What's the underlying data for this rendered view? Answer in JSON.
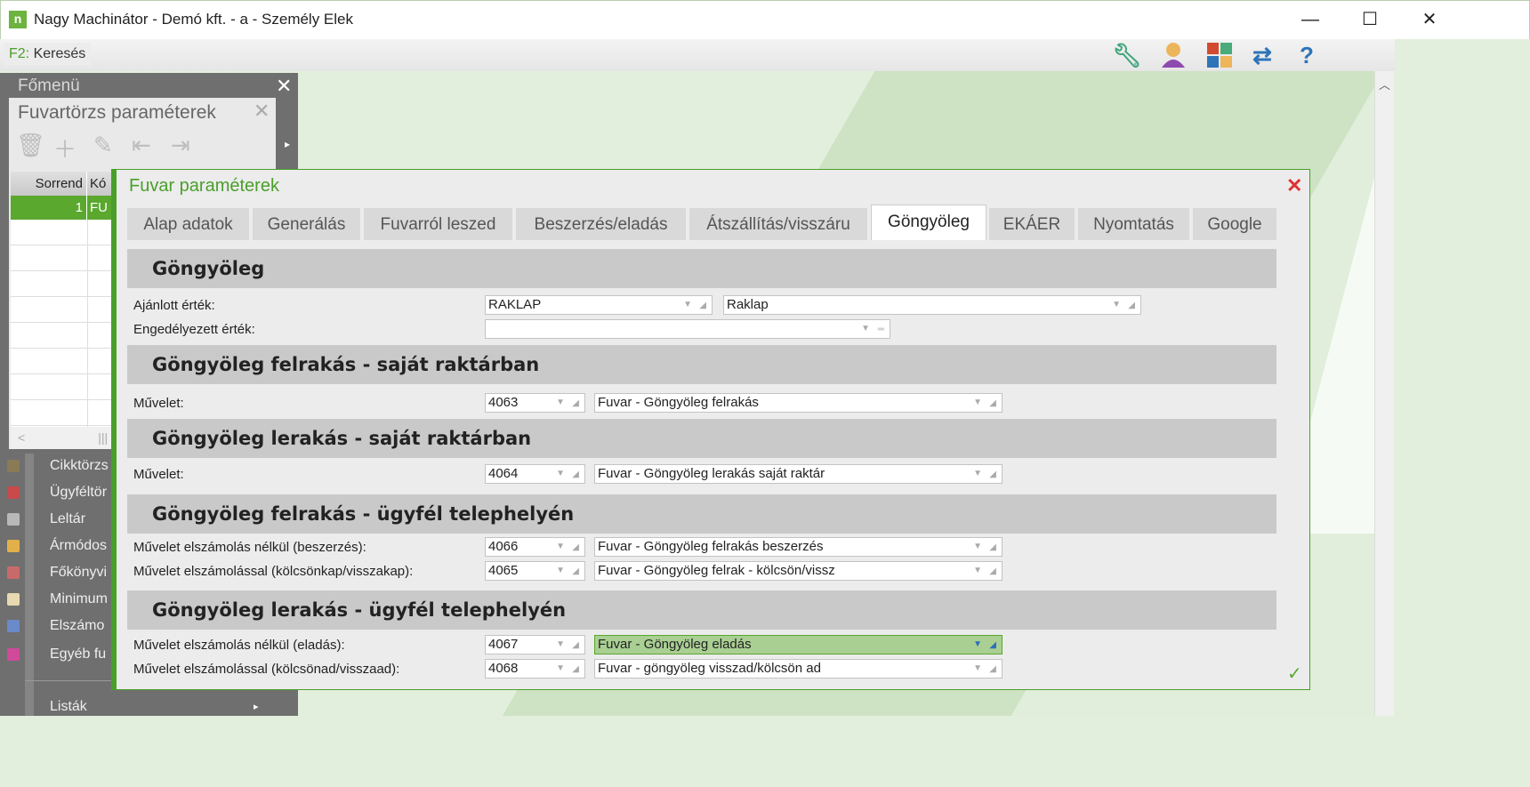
{
  "window": {
    "title": "Nagy Machinátor - Demó kft. - a - Személy Elek",
    "app_icon": "n",
    "minimize": "—",
    "maximize": "☐",
    "close": "✕"
  },
  "toolbar": {
    "search_key": "F2:",
    "search_label": "Keresés",
    "icons": [
      "wrench-icon",
      "user-icon",
      "tiles-icon",
      "swap-icon",
      "help-icon"
    ],
    "help": "?"
  },
  "left": {
    "main_menu": "Főmenü",
    "panel_title": "Fuvartörzs paraméterek",
    "columns": [
      "Sorrend",
      "Kó"
    ],
    "row": [
      "1",
      "FU"
    ],
    "menu": [
      "Cikktörzs",
      "Ügyféltör",
      "Leltár",
      "Ármódos",
      "Főkönyvi",
      "Minimum",
      "Elszámo",
      "Egyéb fu",
      "Listák"
    ]
  },
  "dialog": {
    "title": "Fuvar paraméterek",
    "tabs": [
      "Alap adatok",
      "Generálás",
      "Fuvarról leszed",
      "Beszerzés/eladás",
      "Átszállítás/visszáru",
      "Göngyöleg",
      "EKÁER",
      "Nyomtatás",
      "Google"
    ],
    "active_tab": "Göngyöleg",
    "sections": [
      {
        "title": "Göngyöleg",
        "rows": [
          {
            "label": "Ajánlott érték:",
            "code": "RAKLAP",
            "name": "Raklap"
          },
          {
            "label": "Engedélyezett érték:",
            "code": ""
          }
        ]
      },
      {
        "title": "Göngyöleg felrakás - saját raktárban",
        "rows": [
          {
            "label": "Művelet:",
            "code": "4063",
            "name": "Fuvar - Göngyöleg felrakás"
          }
        ]
      },
      {
        "title": "Göngyöleg lerakás - saját raktárban",
        "rows": [
          {
            "label": "Művelet:",
            "code": "4064",
            "name": "Fuvar - Göngyöleg lerakás saját raktár"
          }
        ]
      },
      {
        "title": "Göngyöleg felrakás - ügyfél telephelyén",
        "rows": [
          {
            "label": "Művelet elszámolás nélkül (beszerzés):",
            "code": "4066",
            "name": "Fuvar - Göngyöleg felrakás beszerzés"
          },
          {
            "label": "Művelet elszámolással (kölcsönkap/visszakap):",
            "code": "4065",
            "name": "Fuvar - Göngyöleg felrak - kölcsön/vissz"
          }
        ]
      },
      {
        "title": "Göngyöleg lerakás - ügyfél telephelyén",
        "rows": [
          {
            "label": "Művelet elszámolás nélkül (eladás):",
            "code": "4067",
            "name": "Fuvar - Göngyöleg eladás"
          },
          {
            "label": "Művelet elszámolással (kölcsönad/visszaad):",
            "code": "4068",
            "name": "Fuvar - göngyöleg visszad/kölcsön ad"
          }
        ]
      }
    ],
    "ok": "✓"
  },
  "colors": {
    "accent": "#4a9f2a",
    "selected": "#a9cf92"
  }
}
